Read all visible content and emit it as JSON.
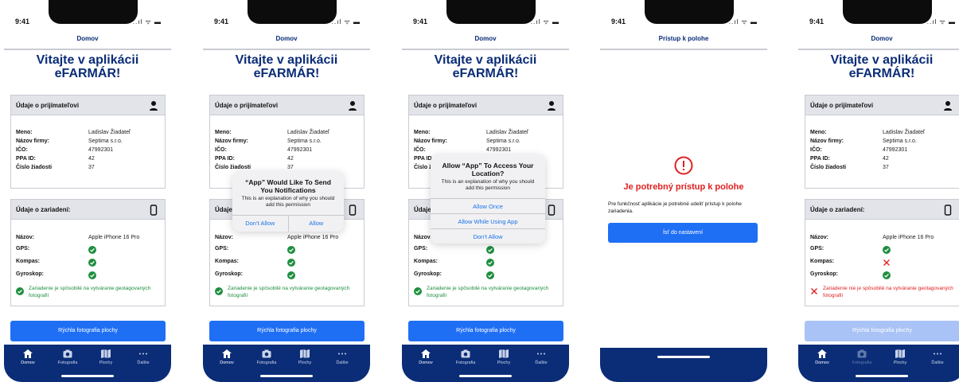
{
  "status": {
    "time": "9:41",
    "icons": "..ıl ᯤ ▬"
  },
  "nav": {
    "home_title": "Domov",
    "location_title": "Prístup k polohe"
  },
  "welcome": "Vitajte v aplikácii eFARMÁR!",
  "recipient": {
    "title": "Údaje o prijímateľovi",
    "rows": [
      {
        "label": "Meno:",
        "value": "Ladislav Žiadateľ"
      },
      {
        "label": "Názov firmy:",
        "value": "Septima s.r.o."
      },
      {
        "label": "IČO:",
        "value": "47992301"
      },
      {
        "label": "PPA ID:",
        "value": "42"
      },
      {
        "label": "Číslo žiadosti",
        "value": "37"
      }
    ]
  },
  "device": {
    "title": "Údaje o zariadení:",
    "name_label": "Názov:",
    "name_value": "Apple iPhone 16 Pro",
    "gps_label": "GPS:",
    "compass_label": "Kompas:",
    "gyro_label": "Gyroskop:",
    "capable_note": "Zariadenie je spôsobilé na vytváranie geotagovaných fotografií",
    "not_capable_note": "Zariadenie nie je spôsobilé na vytváranie geotagovaných fotografií"
  },
  "quick_button": "Rýchla fotografia plochy",
  "tabs": [
    {
      "label": "Domov",
      "icon": "home-icon"
    },
    {
      "label": "Fotografia",
      "icon": "camera-icon"
    },
    {
      "label": "Plochy",
      "icon": "map-icon"
    },
    {
      "label": "Ďalšie",
      "icon": "more-icon"
    }
  ],
  "notification_alert": {
    "title": "“App” Would Like To Send You Notifications",
    "message": "This is an explanation of why you should add this permission",
    "deny": "Don’t Allow",
    "allow": "Allow"
  },
  "location_alert": {
    "title": "Allow “App” To Access Your Location?",
    "message": "This is an explanation of why you should add this permission",
    "allow_once": "Allow Once",
    "allow_while_using": "Allow While Using App",
    "deny": "Don’t Allow"
  },
  "permission_screen": {
    "title": "Je potrebný prístup k polohe",
    "text": "Pre funkčnosť aplikácie je potrebné udeliť prístup k polohe zariadenia.",
    "button": "Ísť do nastavení"
  },
  "colors": {
    "navy": "#0b2d77",
    "blue": "#1f6ff5",
    "green": "#1e8e3e",
    "red": "#e02020"
  }
}
